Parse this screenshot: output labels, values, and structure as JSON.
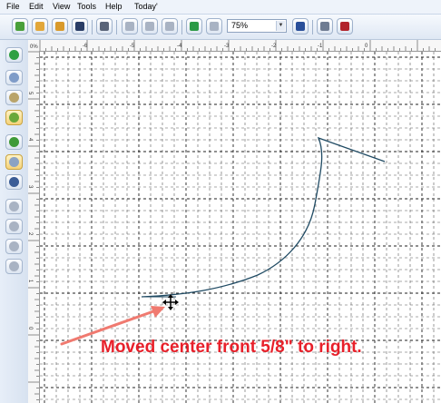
{
  "menu": {
    "items": [
      {
        "label": "File"
      },
      {
        "label": "Edit"
      },
      {
        "label": "View"
      },
      {
        "label": "Tools"
      },
      {
        "label": "Help"
      },
      {
        "label": "Today'"
      }
    ]
  },
  "toolbar": {
    "buttons": [
      {
        "icon": "new-file-icon",
        "color": "#4aa03a"
      },
      {
        "icon": "open-folder-icon",
        "color": "#e2a73a"
      },
      {
        "icon": "open-recent-icon",
        "color": "#d99a2b"
      },
      {
        "icon": "save-icon",
        "color": "#2a3d66"
      },
      {
        "icon": "print-icon",
        "color": "#5a6478"
      },
      {
        "icon": "cut-icon",
        "color": "#a9b3c3"
      },
      {
        "icon": "copy-icon",
        "color": "#a9b3c3"
      },
      {
        "icon": "paste-icon",
        "color": "#a9b3c3"
      },
      {
        "icon": "undo-icon",
        "color": "#2c9a46"
      },
      {
        "icon": "redo-icon",
        "color": "#a9b3c3"
      },
      {
        "icon": "info-icon",
        "color": "#2a4f9a"
      },
      {
        "icon": "measure-icon",
        "color": "#6f7c92"
      },
      {
        "icon": "bicycle-icon",
        "color": "#b2232b"
      }
    ],
    "zoom": {
      "value": "75%"
    }
  },
  "left_toolbar": {
    "buttons": [
      {
        "icon": "select-arrow-icon",
        "color": "#2ea043"
      },
      {
        "icon": "zoom-magnifier-icon",
        "color": "#7f9cc8"
      },
      {
        "icon": "pan-hand-icon",
        "color": "#b9a46a"
      },
      {
        "icon": "ruler-tool-icon",
        "color": "#6aa83a",
        "selected": true
      },
      {
        "icon": "drafting-tool-icon",
        "color": "#3f9a38"
      },
      {
        "icon": "grid-settings-icon",
        "color": "#8aa2c4",
        "selected": true
      },
      {
        "icon": "copy-pages-icon",
        "color": "#3a5c96"
      },
      {
        "icon": "move-horizontal-icon",
        "color": "#a9b3c3"
      },
      {
        "icon": "move-vertical-icon",
        "color": "#a9b3c3"
      },
      {
        "icon": "rotate-left-icon",
        "color": "#a9b3c3"
      },
      {
        "icon": "rotate-right-icon",
        "color": "#a9b3c3"
      }
    ]
  },
  "ruler": {
    "top_labels": [
      "-6",
      "-5",
      "-4",
      "-3",
      "-2",
      "-1",
      "0"
    ],
    "left_labels": [
      "5",
      "4",
      "3",
      "2",
      "1",
      "0"
    ],
    "corner_label": "0%"
  },
  "annotation": {
    "text": "Moved center front 5/8\" to right.",
    "color": "#e8202a",
    "arrow_color": "#f07a70"
  },
  "drawing": {
    "curve_color": "#1f4a63"
  }
}
